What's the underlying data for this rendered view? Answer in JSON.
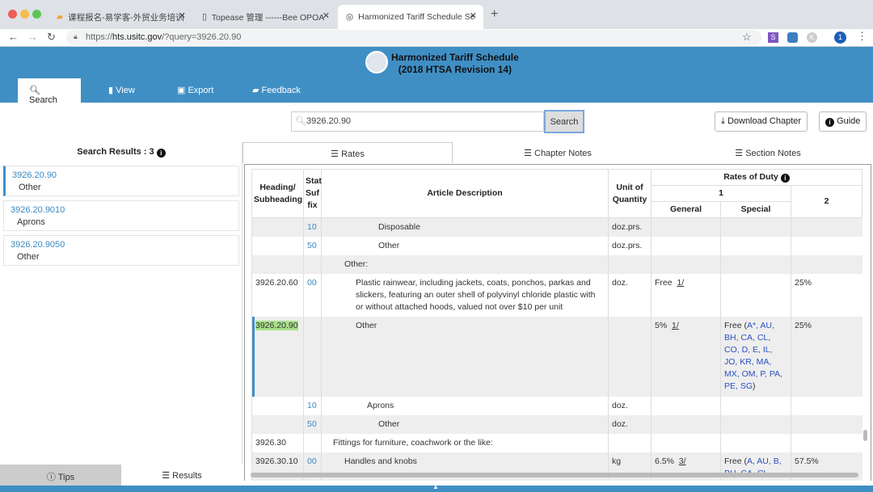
{
  "browser": {
    "tabs": [
      {
        "label": "课程报名-易学客-外贸业务培训"
      },
      {
        "label": "Topease 管理 ------Bee OPOA"
      },
      {
        "label": "Harmonized Tariff Schedule Se"
      }
    ],
    "url_prefix": "https://",
    "url_host": "hts.usitc.gov",
    "url_path": "/?query=3926.20.90",
    "profile_letter": "1",
    "ext_s": "S",
    "ext_k": "K"
  },
  "header": {
    "title_line1": "Harmonized Tariff Schedule",
    "title_line2": "(2018 HTSA Revision 14)",
    "nav": [
      "Search",
      "View",
      "Export",
      "Feedback"
    ]
  },
  "search": {
    "value": "3926.20.90",
    "button": "Search",
    "download": "Download Chapter",
    "guide": "Guide"
  },
  "left": {
    "heading": "Search Results : 3",
    "results": [
      {
        "code": "3926.20.90",
        "desc": "Other"
      },
      {
        "code": "3926.20.9010",
        "desc": "Aprons"
      },
      {
        "code": "3926.20.9050",
        "desc": "Other"
      }
    ],
    "tips": "Tips",
    "results_tab": "Results"
  },
  "tabs": [
    "Rates",
    "Chapter Notes",
    "Section Notes"
  ],
  "table": {
    "headers": {
      "heading": "Heading/ Subheading",
      "stat": "Stat Suf fix",
      "desc": "Article Description",
      "unit": "Unit of Quantity",
      "rates": "Rates of Duty",
      "col1": "1",
      "general": "General",
      "special": "Special",
      "col2": "2"
    },
    "rows": [
      {
        "heading": "",
        "stat": "10",
        "desc": "Disposable",
        "unit": "doz.prs.",
        "general": "",
        "note": "",
        "special": "",
        "col2": ""
      },
      {
        "heading": "",
        "stat": "50",
        "desc": "Other",
        "unit": "doz.prs.",
        "general": "",
        "note": "",
        "special": "",
        "col2": ""
      },
      {
        "heading": "",
        "stat": "",
        "desc": "Other:",
        "unit": "",
        "general": "",
        "note": "",
        "special": "",
        "col2": ""
      },
      {
        "heading": "3926.20.60",
        "stat": "00",
        "desc": "Plastic rainwear, including jackets, coats, ponchos, parkas and slickers, featuring an outer shell of polyvinyl chloride plastic with or without attached hoods, valued not over $10 per unit",
        "unit": "doz.",
        "general": "Free",
        "note": "1/",
        "special": "",
        "col2": "25%"
      },
      {
        "heading": "3926.20.90",
        "stat": "",
        "desc": "Other",
        "unit": "",
        "general": "5%",
        "note": "1/",
        "special_pre": "Free (",
        "special": "A*, AU, BH, CA, CL, CO, D, E, IL, JO, KR, MA, MX, OM, P, PA, PE, SG",
        "special_post": ")",
        "col2": "25%"
      },
      {
        "heading": "",
        "stat": "10",
        "desc": "Aprons",
        "unit": "doz.",
        "general": "",
        "note": "",
        "special": "",
        "col2": ""
      },
      {
        "heading": "",
        "stat": "50",
        "desc": "Other",
        "unit": "doz.",
        "general": "",
        "note": "",
        "special": "",
        "col2": ""
      },
      {
        "heading": "3926.30",
        "stat": "",
        "desc": "Fittings for furniture, coachwork or the like:",
        "unit": "",
        "general": "",
        "note": "",
        "special": "",
        "col2": ""
      },
      {
        "heading": "3926.30.10",
        "stat": "00",
        "desc": "Handles and knobs",
        "unit": "kg",
        "general": "6.5%",
        "note": "3/",
        "special_pre": "Free (",
        "special": "A, AU, B, BH, CA, CL,",
        "special_post": "",
        "col2": "57.5%"
      }
    ]
  },
  "colors": {
    "brand": "#3f8fc5",
    "highlight": "#a8e08a",
    "link": "#2b4fbf"
  }
}
